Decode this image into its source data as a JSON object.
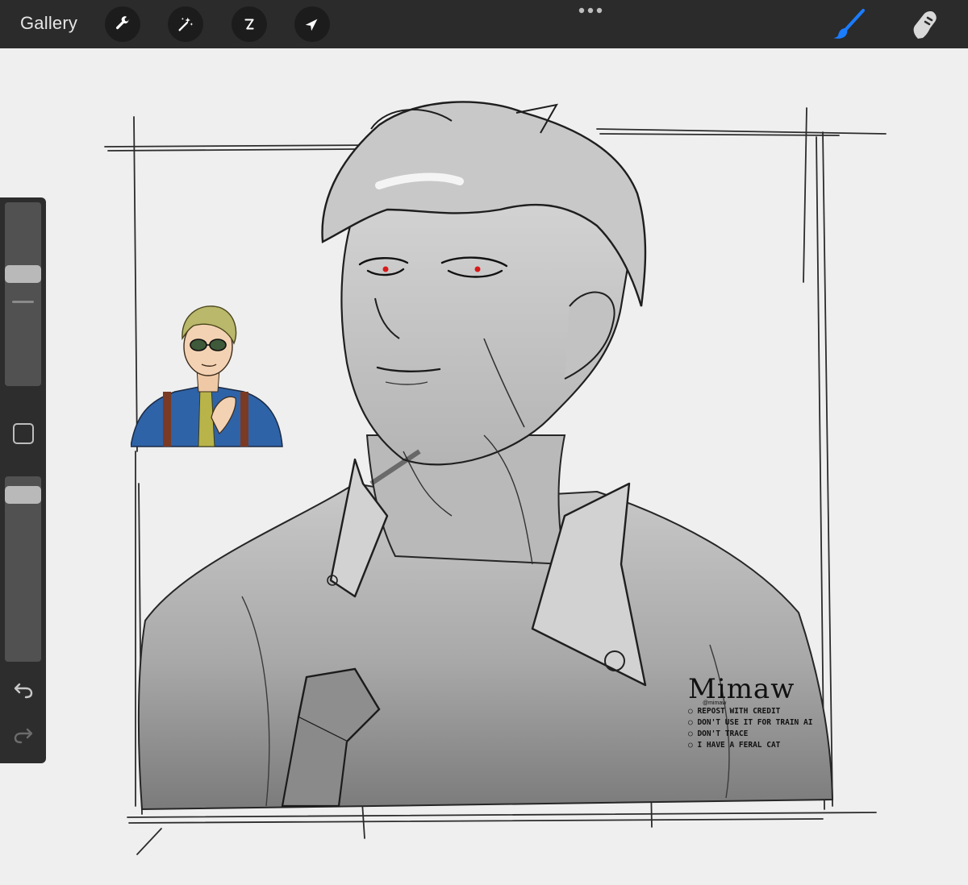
{
  "app": {
    "name": "Procreate"
  },
  "topbar": {
    "gallery_label": "Gallery",
    "tools": [
      {
        "name": "actions",
        "icon": "wrench-icon"
      },
      {
        "name": "adjustments",
        "icon": "magic-wand-icon"
      },
      {
        "name": "selection",
        "icon": "selection-s-icon"
      },
      {
        "name": "transform",
        "icon": "arrow-cursor-icon"
      }
    ],
    "more_icon": "ellipsis-icon",
    "right_tools": [
      {
        "name": "brush",
        "icon": "brush-icon",
        "active": true,
        "color": "#1a7cff"
      },
      {
        "name": "smudge",
        "icon": "smudge-finger-icon",
        "active": false,
        "color": "#d9d9d9"
      }
    ]
  },
  "sidebar": {
    "brush_size_level": 0.62,
    "opacity_level": 0.94,
    "modify_icon": "square-modify-icon",
    "undo_icon": "undo-icon",
    "redo_icon": "redo-icon"
  },
  "canvas": {
    "background": "#efefef",
    "reference_image": "reference-character-icon",
    "artwork": "grayscale-portrait-sketch",
    "watermark": {
      "logo": "Mimaw",
      "handle": "@mimaw",
      "rules": [
        "REPOST WITH CREDIT",
        "DON'T USE IT FOR TRAIN AI",
        "DON'T TRACE",
        "I HAVE A FERAL CAT"
      ]
    }
  }
}
